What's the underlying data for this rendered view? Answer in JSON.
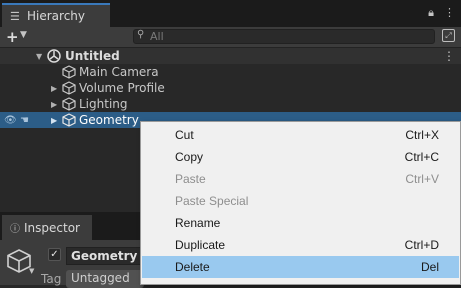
{
  "hierarchy": {
    "tab_label": "Hierarchy",
    "search_placeholder": "All",
    "scene": "Untitled",
    "items": [
      {
        "label": "Main Camera",
        "has_children": false
      },
      {
        "label": "Volume Profile",
        "has_children": true
      },
      {
        "label": "Lighting",
        "has_children": true
      },
      {
        "label": "Geometry",
        "has_children": true,
        "selected": true
      }
    ]
  },
  "inspector": {
    "tab_label": "Inspector",
    "object_name": "Geometry",
    "tag_label": "Tag",
    "tag_value": "Untagged"
  },
  "context_menu": {
    "items": [
      {
        "label": "Cut",
        "shortcut": "Ctrl+X",
        "enabled": true
      },
      {
        "label": "Copy",
        "shortcut": "Ctrl+C",
        "enabled": true
      },
      {
        "label": "Paste",
        "shortcut": "Ctrl+V",
        "enabled": false
      },
      {
        "label": "Paste Special",
        "shortcut": "",
        "enabled": false
      },
      {
        "label": "Rename",
        "shortcut": "",
        "enabled": true
      },
      {
        "label": "Duplicate",
        "shortcut": "Ctrl+D",
        "enabled": true
      },
      {
        "label": "Delete",
        "shortcut": "Del",
        "enabled": true,
        "highlighted": true
      }
    ]
  },
  "colors": {
    "selection": "#2c5d87",
    "menu_hover": "#99c9ef",
    "tab_accent": "#3a79bb"
  }
}
